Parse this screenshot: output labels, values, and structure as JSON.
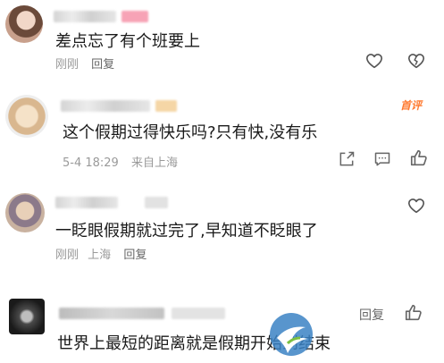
{
  "comments": [
    {
      "text": "差点忘了有个班要上",
      "time": "刚刚",
      "reply": "回复",
      "location": "",
      "badge": ""
    },
    {
      "text": "这个假期过得快乐吗?只有快,没有乐",
      "time": "5-4 18:29",
      "reply": "",
      "location": "来自上海",
      "badge": "首评"
    },
    {
      "text": "一眨眼假期就过完了,早知道不眨眼了",
      "time": "刚刚",
      "reply": "回复",
      "location": "上海",
      "badge": ""
    },
    {
      "text": "世界上最短的距离就是假期开始到结束",
      "time": "",
      "reply": "回复",
      "location": "",
      "badge": ""
    }
  ],
  "icons": [
    "heart-icon",
    "broken-heart-icon",
    "share-icon",
    "message-icon",
    "thumb-up-icon"
  ],
  "colors": {
    "text": "#1a1a1a",
    "meta": "#9a9a9a",
    "badge": "#ff7a30",
    "icon": "#666666"
  }
}
